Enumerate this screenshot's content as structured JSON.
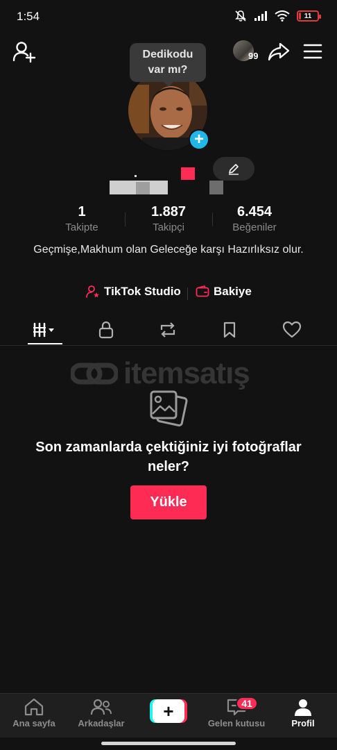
{
  "status_bar": {
    "time": "1:54",
    "battery": "11",
    "battery_fraction": 0.11,
    "icons": [
      "mute-icon",
      "signal-icon",
      "wifi-icon",
      "battery-icon"
    ]
  },
  "top_nav": {
    "visitor_count": "99",
    "icons": [
      "add-friend-icon",
      "share-icon",
      "menu-icon"
    ]
  },
  "profile": {
    "tooltip": "Dedikodu var mı?",
    "stats": [
      {
        "value": "1",
        "label": "Takipte"
      },
      {
        "value": "1.887",
        "label": "Takipçi"
      },
      {
        "value": "6.454",
        "label": "Beğeniler"
      }
    ],
    "bio": "Geçmişe,Makhum olan Geleceğe karşı Hazırlıksız olur.",
    "studio_label": "TikTok Studio",
    "balance_label": "Bakiye"
  },
  "tabs": [
    "videos-grid-icon",
    "lock-icon",
    "repost-icon",
    "bookmark-icon",
    "heart-icon"
  ],
  "watermark": "itemsatış",
  "empty_state": {
    "title": "Son zamanlarda çektiğiniz iyi fotoğraflar neler?",
    "button": "Yükle"
  },
  "bottom_nav": {
    "items": [
      {
        "label": "Ana sayfa",
        "icon": "home-icon"
      },
      {
        "label": "Arkadaşlar",
        "icon": "friends-icon"
      },
      {
        "label": "",
        "icon": "create-icon"
      },
      {
        "label": "Gelen kutusu",
        "icon": "inbox-icon"
      },
      {
        "label": "Profil",
        "icon": "profile-icon"
      }
    ],
    "inbox_badge": "41"
  },
  "colors": {
    "accent": "#fe2c55",
    "background": "#121212",
    "add_button": "#20b6e8"
  }
}
